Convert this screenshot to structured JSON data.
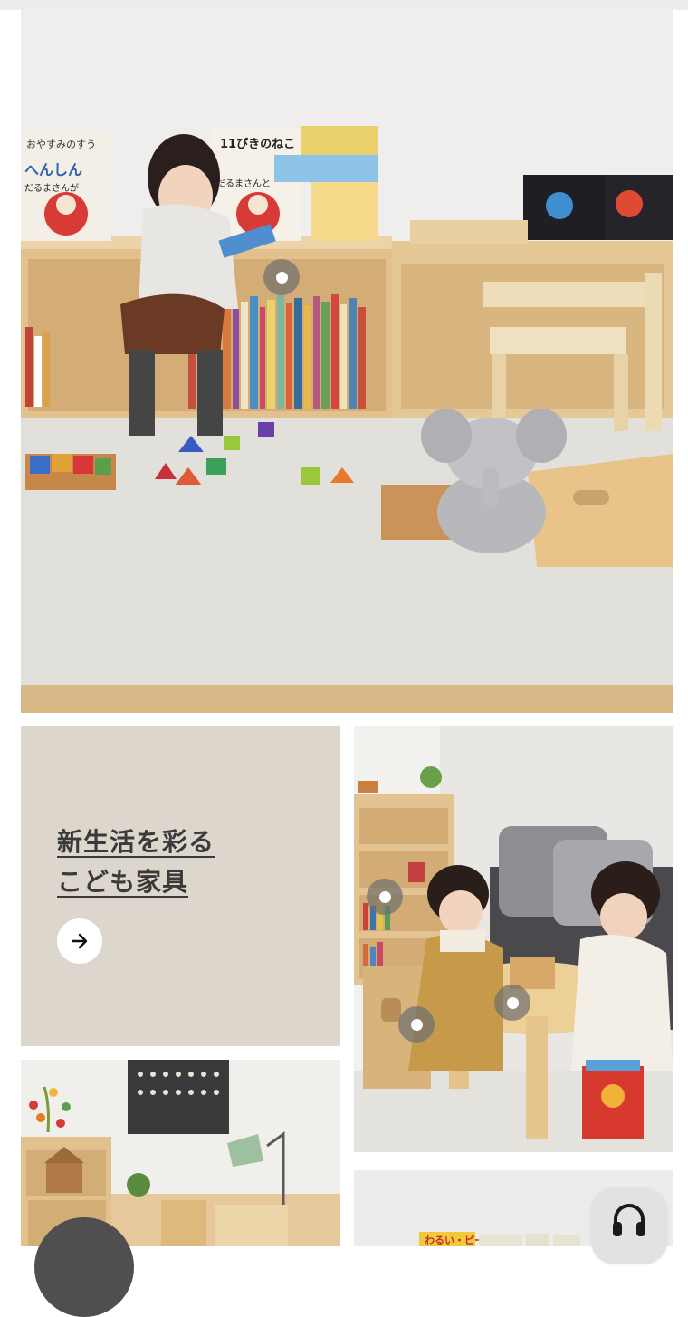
{
  "promo": {
    "title_line1": "新生活を彩る",
    "title_line2": "こども家具"
  },
  "icons": {
    "arrow": "arrow-right-icon",
    "hotspot": "dot-icon",
    "support": "headset-icon"
  },
  "colors": {
    "promo_bg": "#dcd6cc",
    "promo_text": "#3a3a3a",
    "hotspot": "#6e6e6e",
    "wood": "#e6c99a",
    "rug": "#ebe9e4"
  },
  "hero_book_labels": [
    "おやすみのすう",
    "11ぴきのねこ",
    "へんしん",
    "だるまさんが",
    "だるまさんと"
  ],
  "shelf_book_labels": [
    "わるい・ピート"
  ]
}
